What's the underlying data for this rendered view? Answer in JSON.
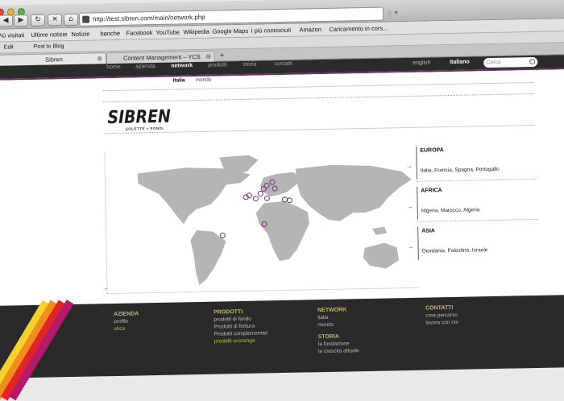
{
  "browser": {
    "url": "http://test.sibren.com/main/network.php",
    "bookmarks": [
      "Più visitati",
      "Ultime notizie",
      "Notizie",
      "banche",
      "Facebook",
      "YouTube",
      "Wikipedia",
      "Google Maps",
      "I più conosciuti",
      "Amazon",
      "Caricamento in cors..."
    ],
    "extensions": [
      "Edit",
      "Post to Blog"
    ],
    "tabs": [
      {
        "label": "Sibren",
        "active": true
      },
      {
        "label": "Content Management – YCS",
        "active": false
      }
    ],
    "new_tab_label": "+"
  },
  "site": {
    "nav": [
      "home",
      "azienda",
      "network",
      "prodotti",
      "storia",
      "contatti"
    ],
    "active_nav": "network",
    "languages": {
      "english": "english",
      "italiano": "italiano"
    },
    "search_placeholder": "Cerca",
    "subnav": [
      "italia",
      "mondo"
    ],
    "logo": {
      "main": "SIBREN",
      "tagline": "SOLETTE + FONDI"
    },
    "regions": [
      {
        "title": "EUROPA",
        "countries": "Italia, Francia, Spagna, Portogallo"
      },
      {
        "title": "AFRICA",
        "countries": "Nigeria, Marocco, Algeria"
      },
      {
        "title": "ASIA",
        "countries": "Giordania, Palestina, Israele"
      }
    ],
    "map_markers": [
      "europe-1",
      "europe-2",
      "europe-3",
      "europe-4",
      "europe-5",
      "europe-6",
      "europe-7",
      "europe-8",
      "africa-nw",
      "middle-east-1",
      "middle-east-2",
      "nigeria",
      "brazil"
    ]
  },
  "footer": {
    "azienda": {
      "title": "AZIENDA",
      "items": [
        "profilo",
        "etica"
      ]
    },
    "prodotti": {
      "title": "PRODOTTI",
      "items": [
        "prodotti di fondo",
        "Prodotti di finitura",
        "Prodotti complementari",
        "prodotti ecoranga"
      ]
    },
    "network": {
      "title": "NETWORK",
      "items": [
        "italia",
        "mondo"
      ]
    },
    "storia": {
      "title": "STORIA",
      "items": [
        "la fondazione",
        "la crescita attuale"
      ]
    },
    "contatti": {
      "title": "CONTATTI",
      "items": [
        "crea percorso",
        "lavora con noi"
      ]
    }
  },
  "colors": {
    "accent": "#6a2b6a",
    "footer": "#2a2a2a",
    "map": "#b5b5b5"
  }
}
